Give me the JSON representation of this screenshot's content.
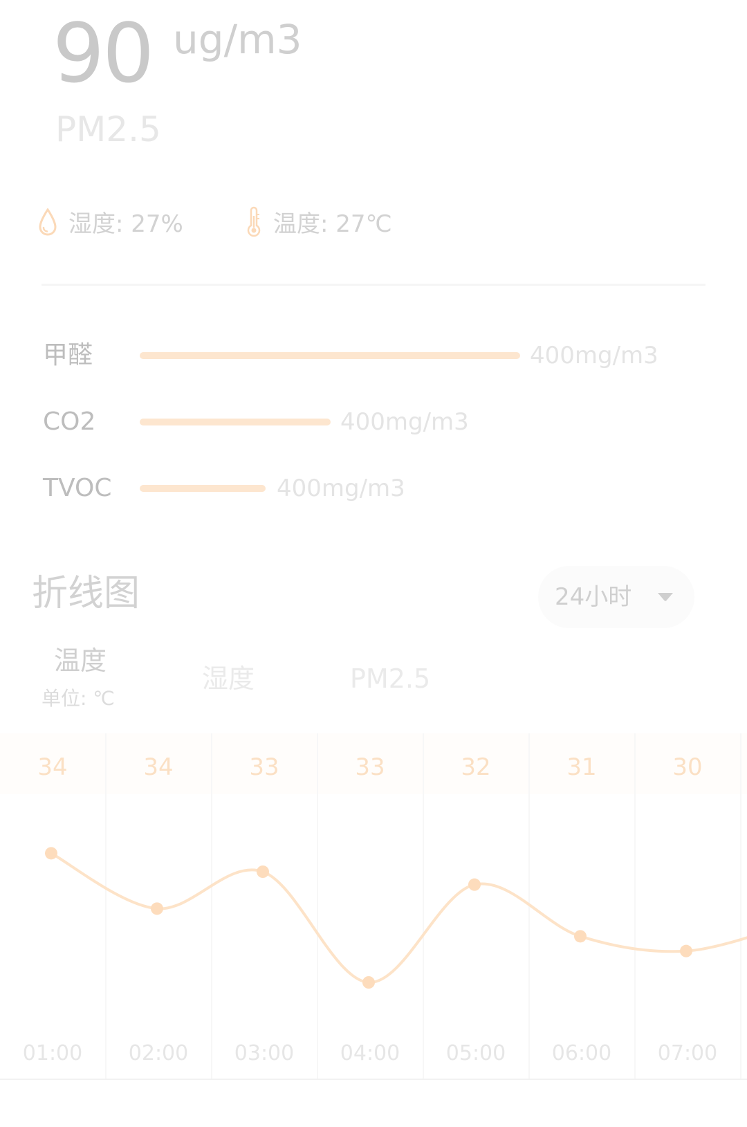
{
  "pm25": {
    "value": "90",
    "unit": "ug/m3",
    "label": "PM2.5"
  },
  "environment": {
    "humidity_text": "湿度: 27%",
    "humidity_icon": "water-drop-icon",
    "temperature_text": "温度: 27℃",
    "temperature_icon": "thermometer-icon"
  },
  "pollutants": [
    {
      "name": "甲醛",
      "value": "400mg/m3",
      "level": 1.0
    },
    {
      "name": "CO2",
      "value": "400mg/m3",
      "level": 0.5
    },
    {
      "name": "TVOC",
      "value": "400mg/m3",
      "level": 0.33
    }
  ],
  "chart_section": {
    "title": "折线图",
    "range": "24小时",
    "tabs": [
      {
        "label": "温度",
        "unit": "单位: ℃",
        "active": true
      },
      {
        "label": "湿度",
        "active": false
      },
      {
        "label": "PM2.5",
        "active": false
      }
    ]
  },
  "colors": {
    "accent": "#fde6cf",
    "accent_line": "#fde3c8",
    "accent_point": "#fddcbc",
    "value_text": "#fbe0c4"
  },
  "chart_data": {
    "type": "line",
    "x": [
      "01:00",
      "02:00",
      "03:00",
      "04:00",
      "05:00",
      "06:00",
      "07:00"
    ],
    "value_labels": [
      "34",
      "34",
      "33",
      "33",
      "32",
      "31",
      "30"
    ],
    "series": [
      {
        "values": [
          34,
          31,
          33,
          27,
          32.3,
          29.5,
          28.7,
          30.2
        ]
      }
    ],
    "grid": true
  }
}
